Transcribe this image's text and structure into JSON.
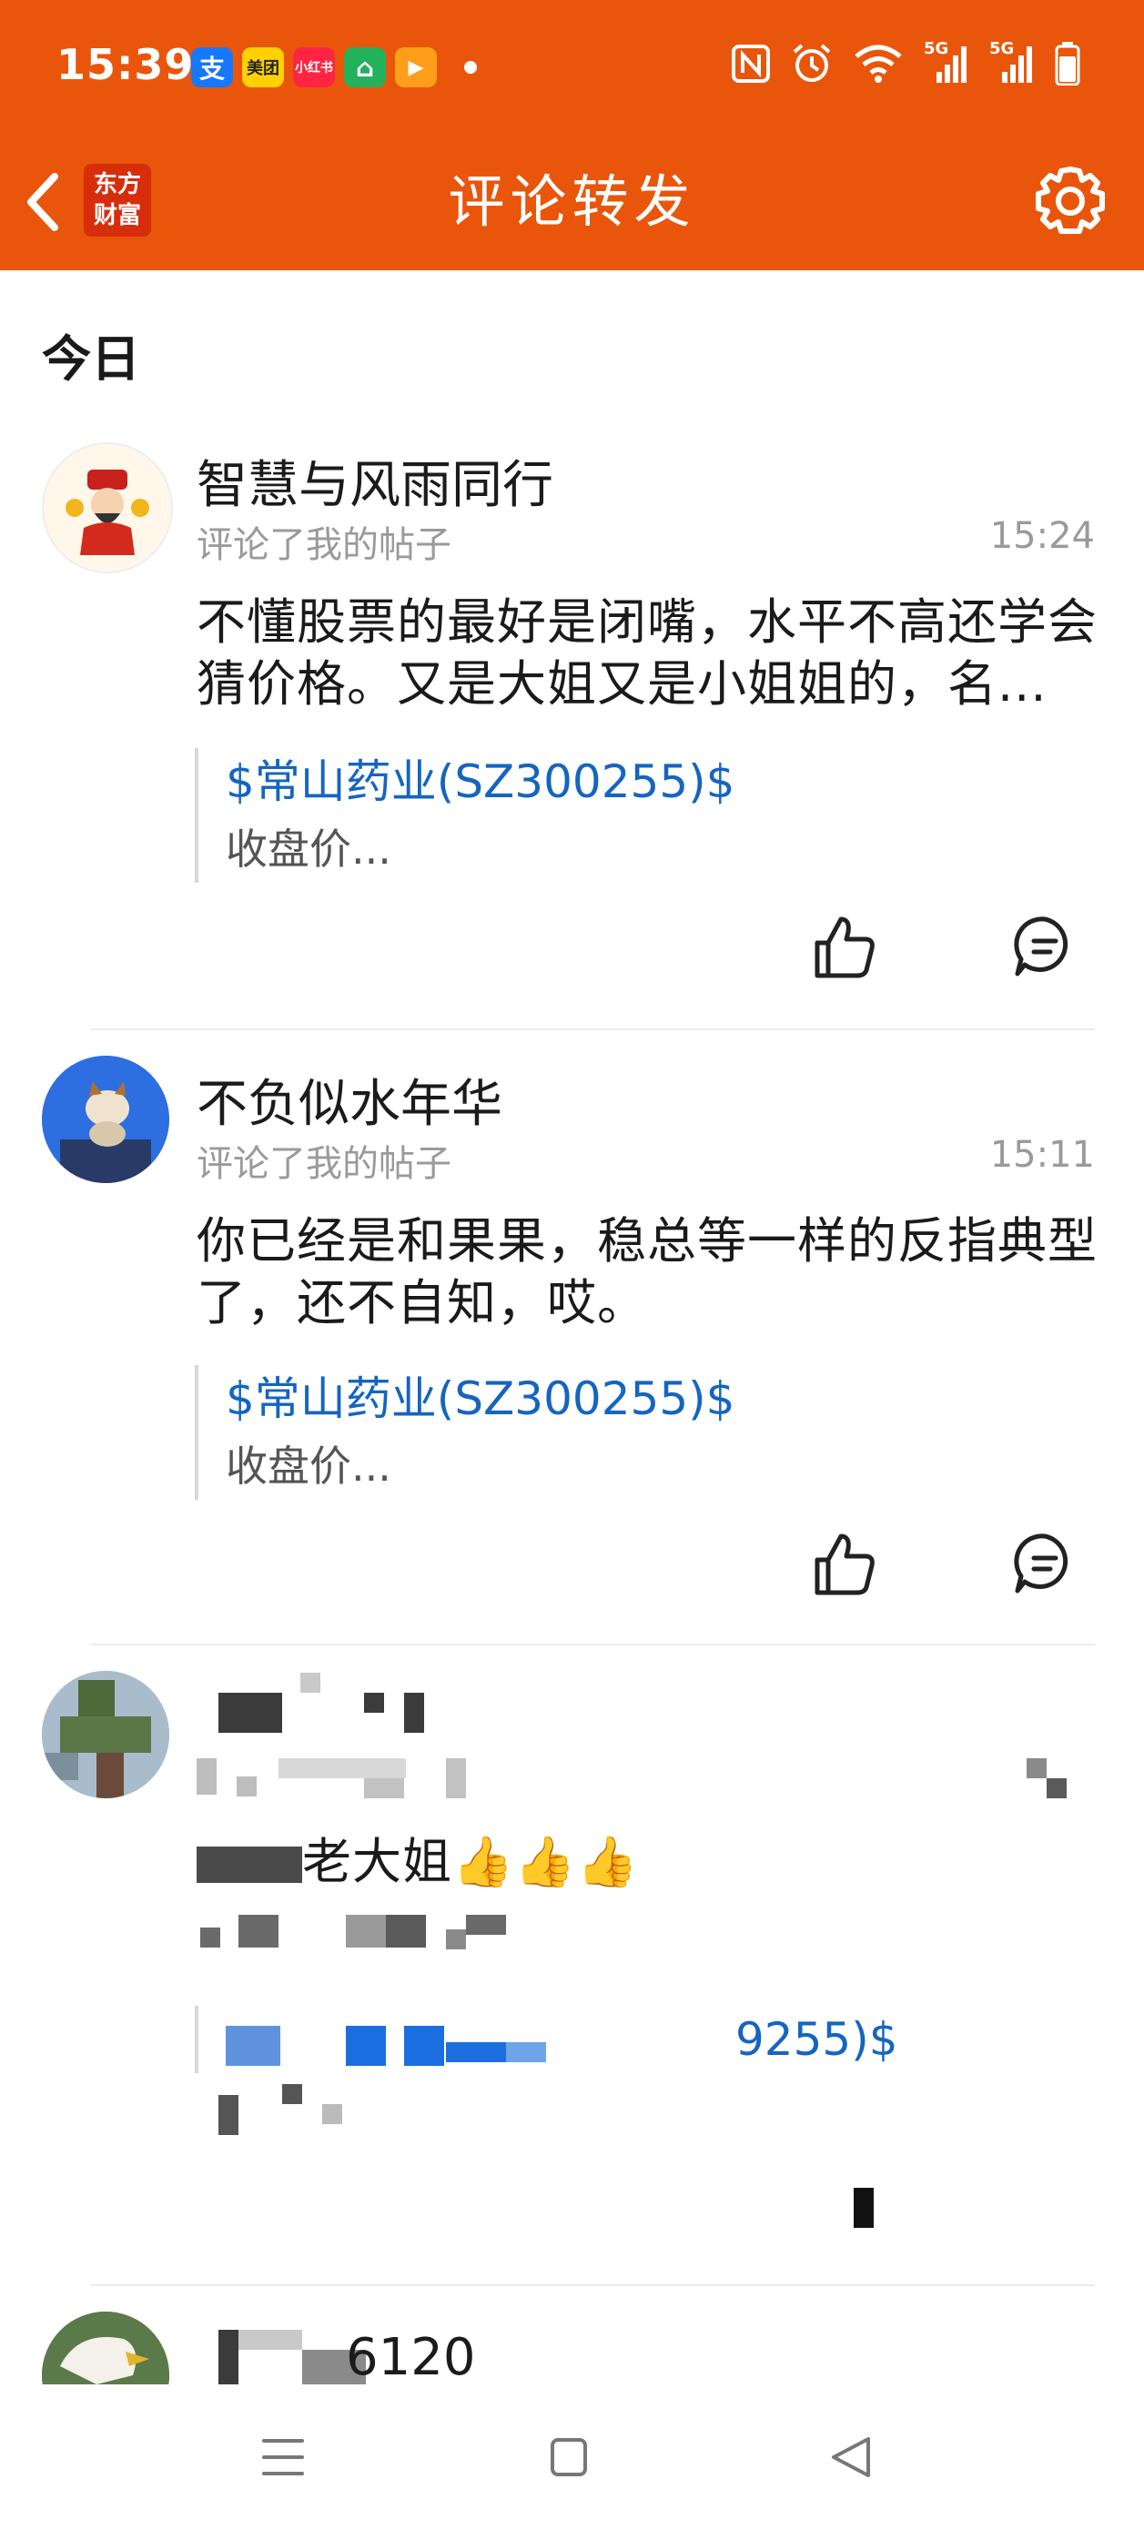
{
  "status_bar": {
    "time": "15:39",
    "notif_apps": [
      {
        "label": "支",
        "color": "#1677ff"
      },
      {
        "label": "美团",
        "color": "#ffd100"
      },
      {
        "label": "小红书",
        "color": "#ff2442"
      },
      {
        "label": "⌂",
        "color": "#21b25b"
      },
      {
        "label": "▶",
        "color": "#ff9e1b"
      }
    ],
    "network_labels": [
      "5G",
      "5G"
    ]
  },
  "header": {
    "title": "评论转发",
    "logo_text": "东方财富",
    "background": "#e9560b"
  },
  "section": {
    "title": "今日"
  },
  "items": [
    {
      "username": "智慧与风雨同行",
      "action": "评论了我的帖子",
      "time": "15:24",
      "content": "不懂股票的最好是闭嘴，水平不高还学会猜价格。又是大姐又是小姐姐的，名...",
      "quote_link": "$常山药业(SZ300255)$",
      "quote_text": "收盘价..."
    },
    {
      "username": "不负似水年华",
      "action": "评论了我的帖子",
      "time": "15:11",
      "content": "你已经是和果果，稳总等一样的反指典型了，还不自知，哎。",
      "quote_link": "$常山药业(SZ300255)$",
      "quote_text": "收盘价..."
    },
    {
      "content_visible": "老大姐👍👍👍",
      "quote_link_visible": "9255)$"
    },
    {
      "username_visible": "6120"
    }
  ]
}
